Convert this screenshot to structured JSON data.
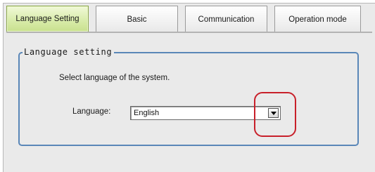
{
  "tabs": [
    {
      "label": "Language Setting",
      "active": true
    },
    {
      "label": "Basic",
      "active": false
    },
    {
      "label": "Communication",
      "active": false
    },
    {
      "label": "Operation mode",
      "active": false
    }
  ],
  "group": {
    "title": "Language setting",
    "description": "Select language of the system.",
    "language_label": "Language:",
    "language_value": "English"
  },
  "icons": {
    "dropdown": "chevron-down-icon"
  },
  "colors": {
    "active_tab": "#d9ecab",
    "group_border": "#5a87b8",
    "highlight": "#c8202a"
  }
}
